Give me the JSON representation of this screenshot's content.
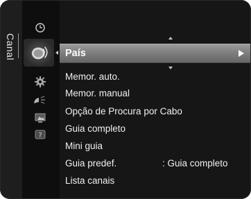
{
  "sidebar": {
    "tab_label": "Canal",
    "icons": [
      "clock-icon",
      "satellite-dish-icon",
      "gear-icon",
      "input-icon",
      "media-icon",
      "help-icon"
    ],
    "active_icon": "satellite-dish-icon"
  },
  "menu": {
    "items": [
      {
        "label": "País",
        "value": "",
        "selected": true
      },
      {
        "label": "Memor. auto.",
        "value": ""
      },
      {
        "label": "Memor. manual",
        "value": ""
      },
      {
        "label": "Opção de Procura por Cabo",
        "value": ""
      },
      {
        "label": "Guia completo",
        "value": ""
      },
      {
        "label": "Mini guia",
        "value": ""
      },
      {
        "label": "Guia predef.",
        "value": ": Guia completo"
      },
      {
        "label": "Lista canais",
        "value": ""
      }
    ]
  },
  "colors": {
    "background": "#151515",
    "selected_bar": "#8a8a8a",
    "text": "#f0f0f0"
  }
}
